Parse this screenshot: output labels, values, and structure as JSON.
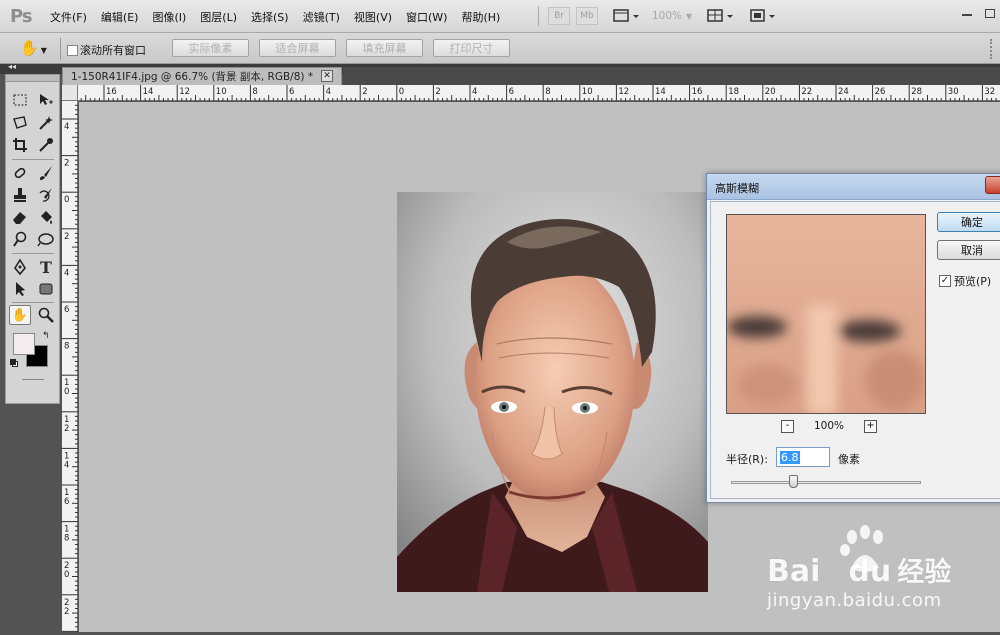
{
  "app": {
    "logo": "Ps"
  },
  "menu": [
    "文件(F)",
    "编辑(E)",
    "图像(I)",
    "图层(L)",
    "选择(S)",
    "滤镜(T)",
    "视图(V)",
    "窗口(W)",
    "帮助(H)"
  ],
  "appbar": {
    "br": "Br",
    "mb": "Mb",
    "zoom": "100%"
  },
  "options": {
    "scroll_all_label": "滚动所有窗口",
    "scroll_all_checked": false,
    "actual_pixels": "实际像素",
    "fit_screen": "适合屏幕",
    "fill_screen": "填充屏幕",
    "print_size": "打印尺寸"
  },
  "document_tab": {
    "title": "1-150R41IF4.jpg @ 66.7% (背景 副本, RGB/8) *"
  },
  "ruler_top": [
    "16",
    "14",
    "12",
    "10",
    "8",
    "6",
    "4",
    "2",
    "0",
    "2",
    "4",
    "6",
    "8",
    "10",
    "12",
    "14",
    "16",
    "18",
    "20",
    "22",
    "24",
    "26",
    "28",
    "30",
    "32"
  ],
  "ruler_left": [
    "4",
    "2",
    "0",
    "2",
    "4",
    "6",
    "8",
    "10",
    "12",
    "14",
    "16",
    "18",
    "20",
    "22"
  ],
  "dialog": {
    "title": "高斯模糊",
    "ok": "确定",
    "cancel": "取消",
    "preview_label": "预览(P)",
    "preview_checked": true,
    "zoom_out": "-",
    "zoom_in": "+",
    "zoom_level": "100%",
    "radius_label": "半径(R):",
    "radius_value": "6.8",
    "unit": "像素"
  },
  "watermark": {
    "brand_latin_left": "Bai",
    "brand_latin_right": "du",
    "brand_cn": "经验",
    "url": "jingyan.baidu.com"
  },
  "colors": {
    "menubar": "#dcdcdc",
    "workspace": "#c0c0c0",
    "panel_dark": "#535353",
    "dialog_title": "#b5cce8",
    "selection": "#3399ff"
  }
}
